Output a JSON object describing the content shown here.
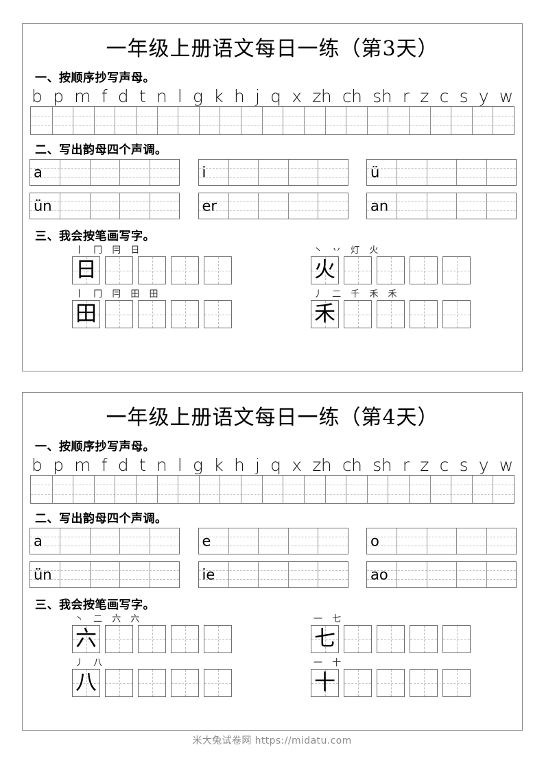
{
  "worksheets": [
    {
      "title": "一年级上册语文每日一练（第3天）",
      "section1": {
        "heading": "一、按顺序抄写声母。",
        "letters": [
          "b",
          "p",
          "m",
          "f",
          "d",
          "t",
          "n",
          "l",
          "g",
          "k",
          "h",
          "j",
          "q",
          "x",
          "zh",
          "ch",
          "sh",
          "r",
          "z",
          "c",
          "s",
          "y",
          "w"
        ]
      },
      "section2": {
        "heading": "二、写出韵母四个声调。",
        "rows": [
          [
            "a",
            "i",
            "ü"
          ],
          [
            "ün",
            "er",
            "an"
          ]
        ],
        "cells_per_box": 5
      },
      "section3": {
        "heading": "三、我会按笔画写字。",
        "items": [
          {
            "char": "日",
            "strokes": "丨 冂 冃 日",
            "boxes": 5
          },
          {
            "char": "火",
            "strokes": "丶 丷 灯 火",
            "boxes": 5
          },
          {
            "char": "田",
            "strokes": "丨 冂 冃 田 田",
            "boxes": 5
          },
          {
            "char": "禾",
            "strokes": "丿 二 千 禾 禾",
            "boxes": 5
          }
        ]
      }
    },
    {
      "title": "一年级上册语文每日一练（第4天）",
      "section1": {
        "heading": "一、按顺序抄写声母。",
        "letters": [
          "b",
          "p",
          "m",
          "f",
          "d",
          "t",
          "n",
          "l",
          "g",
          "k",
          "h",
          "j",
          "q",
          "x",
          "zh",
          "ch",
          "sh",
          "r",
          "z",
          "c",
          "s",
          "y",
          "w"
        ]
      },
      "section2": {
        "heading": "二、写出韵母四个声调。",
        "rows": [
          [
            "a",
            "e",
            "o"
          ],
          [
            "ün",
            "ie",
            "ao"
          ]
        ],
        "cells_per_box": 5
      },
      "section3": {
        "heading": "三、我会按笔画写字。",
        "items": [
          {
            "char": "六",
            "strokes": "丶 二 六 六",
            "boxes": 5
          },
          {
            "char": "七",
            "strokes": "一 七",
            "boxes": 5
          },
          {
            "char": "八",
            "strokes": "丿 八",
            "boxes": 5
          },
          {
            "char": "十",
            "strokes": "一 十",
            "boxes": 5
          }
        ]
      }
    }
  ],
  "footer": {
    "text": "米大兔试卷网 https://midatu.com"
  },
  "colors": {
    "border": "#8a8a8a",
    "grid_line": "#8e8e8e",
    "dashed_line": "#c3c3c3",
    "text": "#000000",
    "footer_text": "#8c8c8c"
  }
}
